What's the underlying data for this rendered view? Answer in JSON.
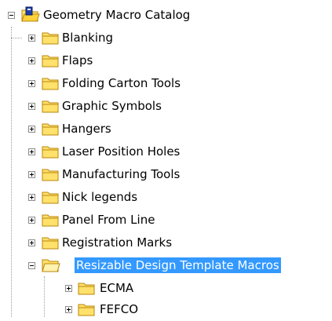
{
  "tree": {
    "root": {
      "label": "Geometry Macro Catalog",
      "icon": "folder-open-macro-icon",
      "expanded": true
    },
    "children": [
      {
        "label": "Blanking",
        "icon": "folder-icon",
        "expanded": false
      },
      {
        "label": "Flaps",
        "icon": "folder-icon",
        "expanded": false
      },
      {
        "label": "Folding Carton Tools",
        "icon": "folder-icon",
        "expanded": false
      },
      {
        "label": "Graphic Symbols",
        "icon": "folder-icon",
        "expanded": false
      },
      {
        "label": "Hangers",
        "icon": "folder-icon",
        "expanded": false
      },
      {
        "label": "Laser Position Holes",
        "icon": "folder-icon",
        "expanded": false
      },
      {
        "label": "Manufacturing Tools",
        "icon": "folder-icon",
        "expanded": false
      },
      {
        "label": "Nick legends",
        "icon": "folder-icon",
        "expanded": false
      },
      {
        "label": "Panel From Line",
        "icon": "folder-icon",
        "expanded": false
      },
      {
        "label": "Registration Marks",
        "icon": "folder-icon",
        "expanded": false
      },
      {
        "label": "Resizable Design Template Macros",
        "icon": "folder-open-icon",
        "expanded": true,
        "selected": true,
        "children": [
          {
            "label": "ECMA",
            "icon": "folder-icon",
            "expanded": false
          },
          {
            "label": "FEFCO",
            "icon": "folder-icon",
            "expanded": false
          }
        ]
      }
    ]
  },
  "colors": {
    "selection": "#3399ff",
    "selection_text": "#ffffff",
    "folder_fill": "#ffe16b",
    "folder_edge": "#b8860b",
    "connector": "#a0a0a0"
  }
}
